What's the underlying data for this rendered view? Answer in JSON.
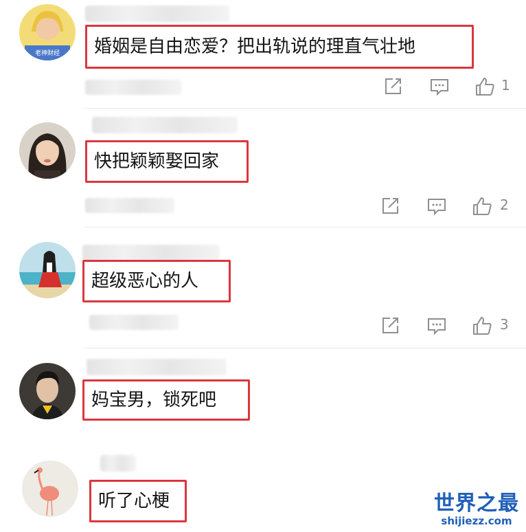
{
  "comments": [
    {
      "text": "婚姻是自由恋爱？把出轨说的理直气壮地",
      "likes": "1",
      "avatar_badge": "老神财经"
    },
    {
      "text": "快把颖颖娶回家",
      "likes": "2"
    },
    {
      "text": "超级恶心的人",
      "likes": "3"
    },
    {
      "text": "妈宝男，锁死吧"
    },
    {
      "text": "听了心梗"
    }
  ],
  "watermark": {
    "cn": "世界之最",
    "en": "shijiezz.com"
  },
  "colors": {
    "highlight": "#d9373d",
    "watermark": "#1f5fb8"
  }
}
